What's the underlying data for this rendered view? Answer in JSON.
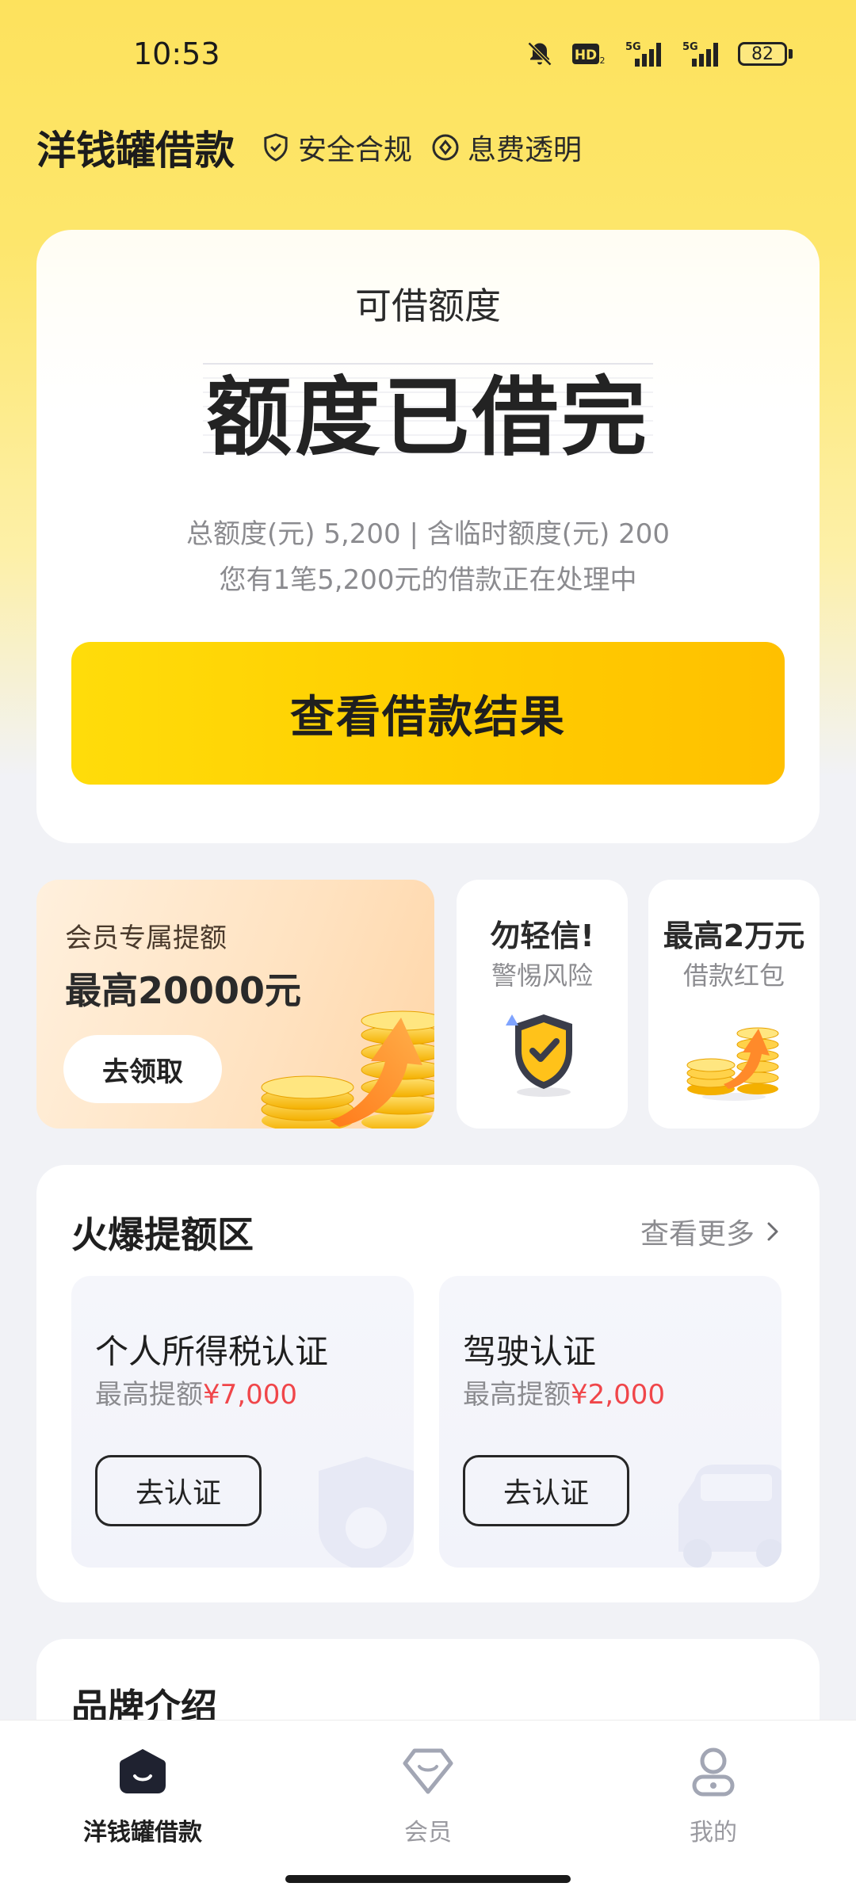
{
  "status_bar": {
    "time": "10:53",
    "battery": "82",
    "hd_badge": "HD",
    "hd_sub": "2",
    "net1": "5G",
    "net2": "5G"
  },
  "header": {
    "title": "洋钱罐借款",
    "tags": [
      {
        "icon": "shield-check-icon",
        "label": "安全合规"
      },
      {
        "icon": "diamond-coin-icon",
        "label": "息费透明"
      }
    ]
  },
  "quota_card": {
    "label": "可借额度",
    "value": "额度已借完",
    "total_line": "总额度(元) 5,200 | 含临时额度(元) 200",
    "processing_line": "您有1笔5,200元的借款正在处理中",
    "button_label": "查看借款结果"
  },
  "promos": {
    "member": {
      "sub": "会员专属提额",
      "main": "最高20000元",
      "button_label": "去领取"
    },
    "risk": {
      "line1": "勿轻信!",
      "line2": "警惕风险"
    },
    "redpacket": {
      "line1": "最高2万元",
      "line2": "借款红包"
    }
  },
  "hot_section": {
    "title": "火爆提额区",
    "see_more": "查看更多",
    "cards": [
      {
        "name": "个人所得税认证",
        "lift_prefix": "最高提额",
        "lift_amount": "¥7,000",
        "button_label": "去认证"
      },
      {
        "name": "驾驶认证",
        "lift_prefix": "最高提额",
        "lift_amount": "¥2,000",
        "button_label": "去认证"
      }
    ]
  },
  "brand": {
    "title": "品牌介绍"
  },
  "bottom_nav": {
    "items": [
      {
        "label": "洋钱罐借款",
        "icon": "home-icon",
        "active": true
      },
      {
        "label": "会员",
        "icon": "member-icon",
        "active": false
      },
      {
        "label": "我的",
        "icon": "profile-icon",
        "active": false
      }
    ]
  },
  "colors": {
    "accent_yellow": "#ffcd00",
    "highlight_red": "#f0464a",
    "muted_gray": "#8c8c90"
  }
}
